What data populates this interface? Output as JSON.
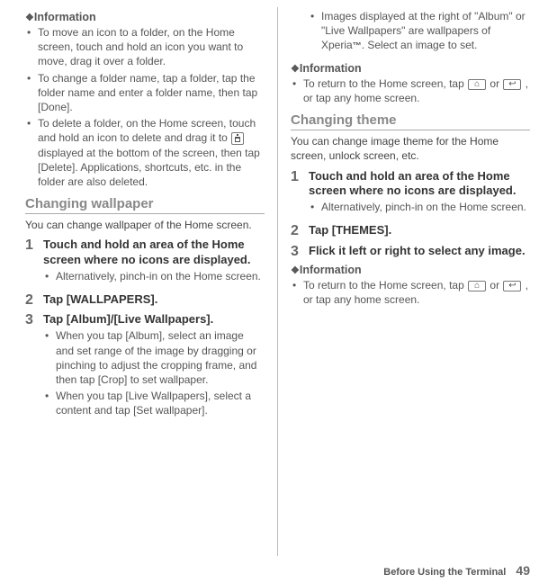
{
  "left": {
    "info_heading": "Information",
    "info_items": [
      "To move an icon to a folder, on the Home screen, touch and hold an icon you want to move, drag it over a folder.",
      "To change a folder name, tap a folder, tap the folder name and enter a folder name, then tap [Done].",
      {
        "pre": "To delete a folder, on the Home screen, touch and hold an icon to delete and drag it to ",
        "icon": "trash",
        "post": " displayed at the bottom of the screen, then tap [Delete]. Applications, shortcuts, etc. in the folder are also deleted."
      }
    ],
    "section_heading": "Changing wallpaper",
    "intro": "You can change wallpaper of the Home screen.",
    "steps": [
      {
        "num": "1",
        "title": "Touch and hold an area of the Home screen where no icons are displayed.",
        "bullets": [
          "Alternatively, pinch-in on the Home screen."
        ]
      },
      {
        "num": "2",
        "title": "Tap [WALLPAPERS]."
      },
      {
        "num": "3",
        "title": "Tap [Album]/[Live Wallpapers].",
        "bullets": [
          "When you tap [Album], select an image and set range of the image by dragging or pinching to adjust the cropping frame, and then tap [Crop] to set wallpaper.",
          "When you tap [Live Wallpapers], select a content and tap [Set wallpaper]."
        ]
      }
    ]
  },
  "right": {
    "top_bullets": [
      {
        "pre": "Images displayed at the right of \"Album\" or \"Live Wallpapers\" are wallpapers of Xperia",
        "tm": "™",
        "post": ". Select an image to set."
      }
    ],
    "info1_heading": "Information",
    "info1_items": [
      {
        "pre": "To return to the Home screen, tap ",
        "mid": " or ",
        "post": " , or tap any home screen."
      }
    ],
    "section_heading": "Changing theme",
    "intro": "You can change image theme for the Home screen, unlock screen, etc.",
    "steps": [
      {
        "num": "1",
        "title": "Touch and hold an area of the Home screen where no icons are displayed.",
        "bullets": [
          "Alternatively, pinch-in on the Home screen."
        ]
      },
      {
        "num": "2",
        "title": "Tap [THEMES]."
      },
      {
        "num": "3",
        "title": "Flick it left or right to select any image."
      }
    ],
    "info2_heading": "Information",
    "info2_items": [
      {
        "pre": "To return to the Home screen, tap ",
        "mid": " or ",
        "post": " , or tap any home screen."
      }
    ]
  },
  "footer": {
    "label": "Before Using the Terminal",
    "page": "49"
  }
}
